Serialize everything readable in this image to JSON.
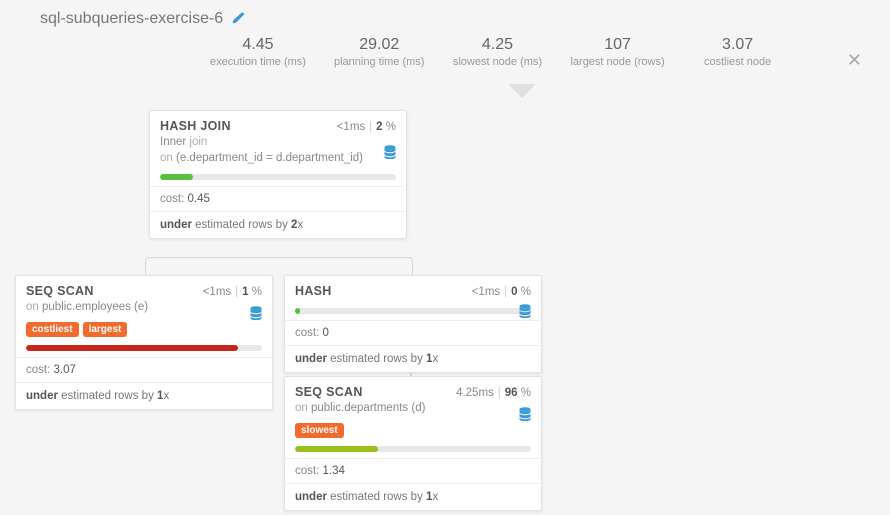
{
  "title": "sql-subqueries-exercise-6",
  "stats": {
    "execution_time": {
      "value": "4.45",
      "label": "execution time (ms)"
    },
    "planning_time": {
      "value": "29.02",
      "label": "planning time (ms)"
    },
    "slowest_node": {
      "value": "4.25",
      "label": "slowest node (ms)"
    },
    "largest_node": {
      "value": "107",
      "label": "largest node (rows)"
    },
    "costliest_node": {
      "value": "3.07",
      "label": "costliest node"
    }
  },
  "nodes": {
    "hash_join": {
      "name": "HASH JOIN",
      "time": "<1ms",
      "pct": "2",
      "pct_suffix": " %",
      "join_kind_prefix": "Inner ",
      "join_kind_suffix": "join",
      "on_prefix": "on ",
      "on_cond": "(e.department_id = d.department_id)",
      "cost_label": "cost: ",
      "cost": "0.45",
      "est_prefix": "under",
      "est_mid": " estimated rows by ",
      "est_factor": "2",
      "est_suffix": "x"
    },
    "seq_scan_emp": {
      "name": "SEQ SCAN",
      "time": "<1ms",
      "pct": "1",
      "pct_suffix": " %",
      "on_prefix": "on ",
      "target": "public.employees (e)",
      "tag_costliest": "costliest",
      "tag_largest": "largest",
      "cost_label": "cost: ",
      "cost": "3.07",
      "est_prefix": "under",
      "est_mid": " estimated rows by ",
      "est_factor": "1",
      "est_suffix": "x"
    },
    "hash": {
      "name": "HASH",
      "time": "<1ms",
      "pct": "0",
      "pct_suffix": " %",
      "cost_label": "cost: ",
      "cost": "0",
      "est_prefix": "under",
      "est_mid": " estimated rows by ",
      "est_factor": "1",
      "est_suffix": "x"
    },
    "seq_scan_dep": {
      "name": "SEQ SCAN",
      "time": "4.25ms",
      "pct": "96",
      "pct_suffix": " %",
      "on_prefix": "on ",
      "target": "public.departments (d)",
      "tag_slowest": "slowest",
      "cost_label": "cost: ",
      "cost": "1.34",
      "est_prefix": "under",
      "est_mid": " estimated rows by ",
      "est_factor": "1",
      "est_suffix": "x"
    }
  }
}
